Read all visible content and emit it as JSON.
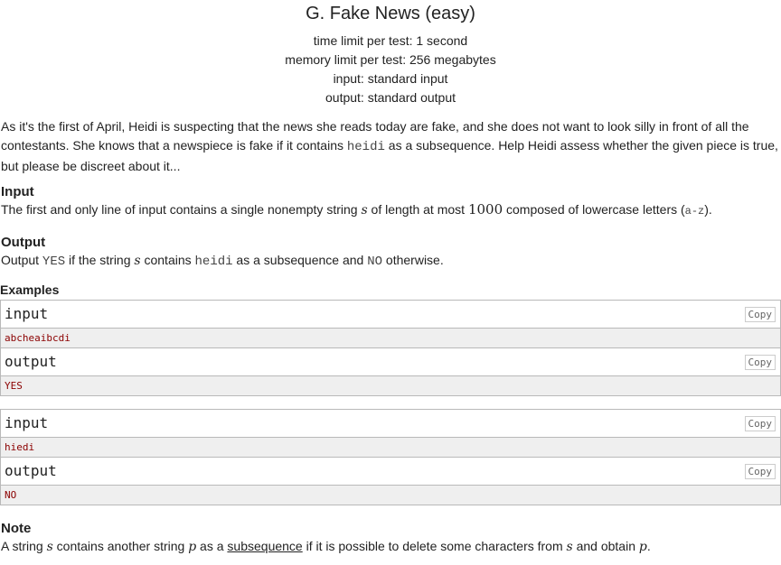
{
  "title": "G. Fake News (easy)",
  "limits": {
    "time": "time limit per test: 1 second",
    "memory": "memory limit per test: 256 megabytes",
    "input": "input: standard input",
    "output": "output: standard output"
  },
  "statement": {
    "p1a": "As it's the first of April, Heidi is suspecting that the news she reads today are fake, and she does not want to look silly in front of all the contestants. She knows that a newspiece is fake if it contains ",
    "p1code": "heidi",
    "p1b": " as a subsequence. Help Heidi assess whether the given piece is true, but please be discreet about it..."
  },
  "input_section": {
    "title": "Input",
    "t1": "The first and only line of input contains a single nonempty string ",
    "var_s": "s",
    "t2": " of length at most ",
    "num": "1000",
    "t3": " composed of lowercase letters (",
    "code": "a-z",
    "t4": ")."
  },
  "output_section": {
    "title": "Output",
    "t1": "Output ",
    "yes": "YES",
    "t2": " if the string ",
    "var_s": "s",
    "t3": " contains ",
    "code": "heidi",
    "t4": " as a subsequence and ",
    "no": "NO",
    "t5": " otherwise."
  },
  "examples": {
    "title": "Examples",
    "input_label": "input",
    "output_label": "output",
    "copy_label": "Copy",
    "ex1_input": "abcheaibcdi",
    "ex1_output": "YES",
    "ex2_input": "hiedi",
    "ex2_output": "NO"
  },
  "note": {
    "title": "Note",
    "t1": "A string ",
    "var_s": "s",
    "t2": " contains another string ",
    "var_p": "p",
    "t3": " as a ",
    "link": "subsequence",
    "t4": " if it is possible to delete some characters from ",
    "t5": " and obtain ",
    "t6": "."
  }
}
